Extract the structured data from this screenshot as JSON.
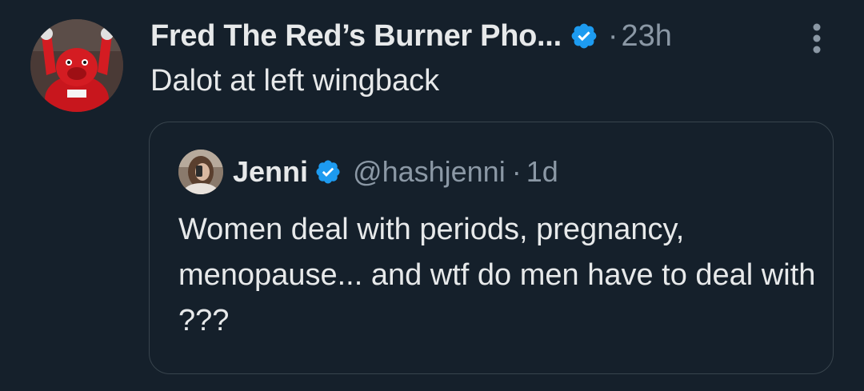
{
  "tweet": {
    "display_name": "Fred The Red’s Burner Pho...",
    "verified": true,
    "separator": "·",
    "time": "23h",
    "text": "Dalot at left wingback",
    "avatar_icon": "red-mascot-avatar",
    "more_icon": "more-vertical-icon"
  },
  "quote": {
    "display_name": "Jenni",
    "verified": true,
    "handle": "@hashjenni",
    "separator": "·",
    "time": "1d",
    "text": "Women deal with periods, pregnancy, menopause... and wtf do men have to deal with ???",
    "avatar_icon": "user-photo-avatar"
  },
  "colors": {
    "background": "#15202b",
    "text_primary": "#e7e9ea",
    "text_secondary": "#8b98a5",
    "verified_blue": "#1d9bf0",
    "border": "#38444d"
  }
}
